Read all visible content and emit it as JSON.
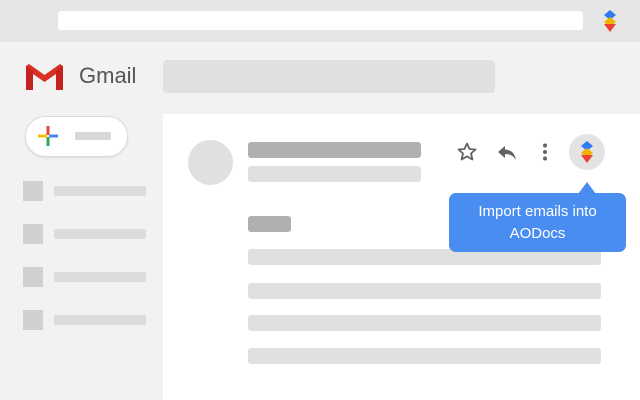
{
  "app": {
    "name": "Gmail"
  },
  "extension": {
    "tooltip": "Import emails into AODocs",
    "icon": "aodocs-logo-icon"
  },
  "toolbar": {
    "icons": [
      "star-icon",
      "reply-icon",
      "more-vert-icon",
      "aodocs-logo-icon"
    ]
  },
  "colors": {
    "tooltip_bg": "#4a8df0",
    "gmail_red": "#d93025",
    "aodocs_blue": "#2f7cf6",
    "aodocs_red": "#ea4335"
  }
}
